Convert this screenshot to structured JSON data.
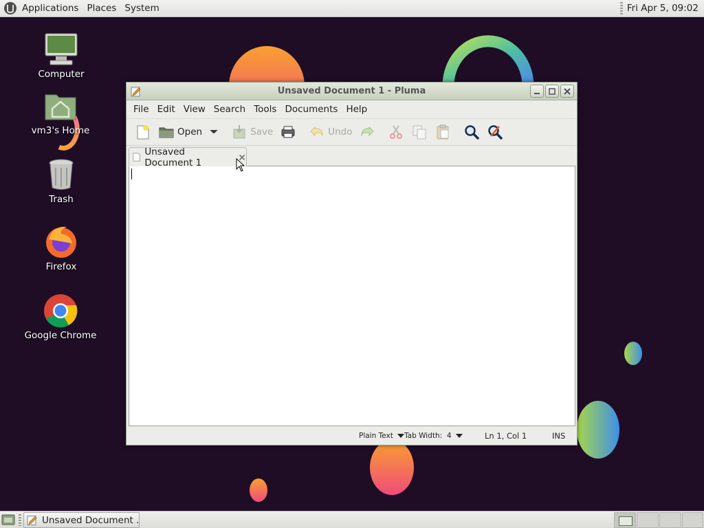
{
  "top_panel": {
    "menus": [
      "Applications",
      "Places",
      "System"
    ],
    "clock": "Fri Apr  5, 09:02"
  },
  "desktop_icons": {
    "computer": "Computer",
    "home": "vm3's Home",
    "trash": "Trash",
    "firefox": "Firefox",
    "chrome": "Google Chrome"
  },
  "window": {
    "title": "Unsaved Document 1 - Pluma",
    "menus": [
      "File",
      "Edit",
      "View",
      "Search",
      "Tools",
      "Documents",
      "Help"
    ],
    "toolbar": {
      "open_label": "Open",
      "save_label": "Save",
      "undo_label": "Undo"
    },
    "tab_label": "Unsaved Document 1",
    "editor_content": "",
    "status": {
      "language": "Plain Text",
      "tab_width": "Tab Width:  4",
      "position": "Ln 1, Col 1",
      "mode": "INS"
    }
  },
  "bottom_panel": {
    "task_label": "Unsaved Document ..."
  },
  "colors": {
    "desktop_bg": "#1f0d26",
    "titlebar": "#c9d0bd",
    "panel": "#e6e6e3"
  }
}
